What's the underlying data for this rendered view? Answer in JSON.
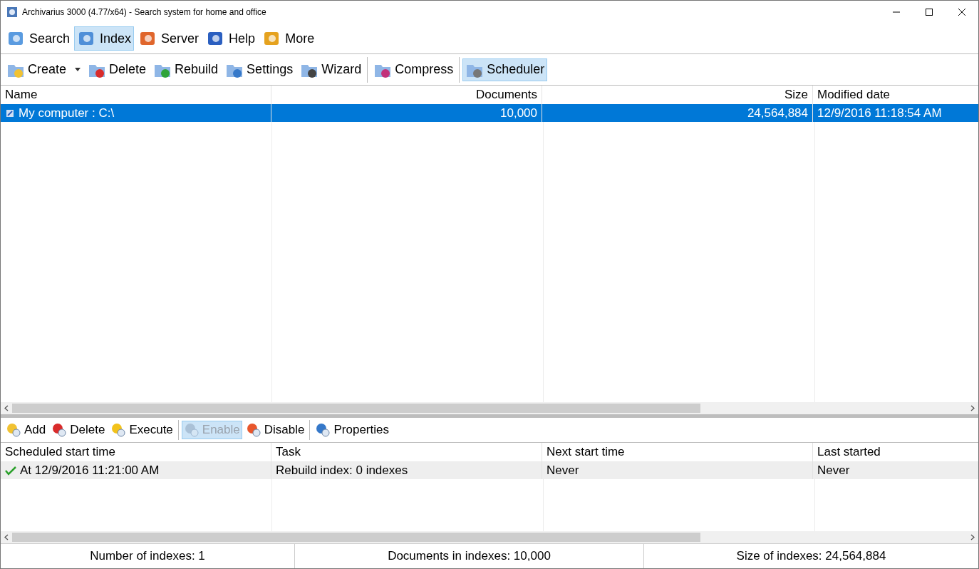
{
  "window": {
    "title": "Archivarius 3000 (4.77/x64) - Search system for home and office"
  },
  "main_toolbar": [
    {
      "label": "Search",
      "selected": false
    },
    {
      "label": "Index",
      "selected": true
    },
    {
      "label": "Server",
      "selected": false
    },
    {
      "label": "Help",
      "selected": false
    },
    {
      "label": "More",
      "selected": false
    }
  ],
  "index_toolbar": [
    {
      "label": "Create",
      "selected": false,
      "dropdown": true
    },
    {
      "label": "Delete",
      "selected": false,
      "dropdown": false
    },
    {
      "label": "Rebuild",
      "selected": false,
      "dropdown": false
    },
    {
      "label": "Settings",
      "selected": false,
      "dropdown": false
    },
    {
      "label": "Wizard",
      "selected": false,
      "dropdown": false
    },
    {
      "label": "Compress",
      "selected": false,
      "dropdown": false
    },
    {
      "label": "Scheduler",
      "selected": true,
      "dropdown": false
    }
  ],
  "index_table": {
    "columns": [
      "Name",
      "Documents",
      "Size",
      "Modified date"
    ],
    "rows": [
      {
        "selected": true,
        "cells": [
          "My computer : C:\\",
          "10,000",
          "24,564,884",
          "12/9/2016 11:18:54 AM"
        ]
      }
    ]
  },
  "scheduler_toolbar": [
    {
      "label": "Add",
      "selected": false,
      "disabled": false
    },
    {
      "label": "Delete",
      "selected": false,
      "disabled": false
    },
    {
      "label": "Execute",
      "selected": false,
      "disabled": false
    },
    {
      "label": "Enable",
      "selected": true,
      "disabled": true
    },
    {
      "label": "Disable",
      "selected": false,
      "disabled": false
    },
    {
      "label": "Properties",
      "selected": false,
      "disabled": false
    }
  ],
  "scheduler_table": {
    "columns": [
      "Scheduled start time",
      "Task",
      "Next start time",
      "Last started"
    ],
    "rows": [
      {
        "selected": true,
        "enabled": true,
        "cells": [
          "At 12/9/2016 11:21:00 AM",
          "Rebuild index: 0 indexes",
          "Never",
          "Never"
        ]
      }
    ]
  },
  "status_bar": [
    "Number of indexes: 1",
    "Documents in indexes: 10,000",
    "Size of indexes: 24,564,884"
  ]
}
